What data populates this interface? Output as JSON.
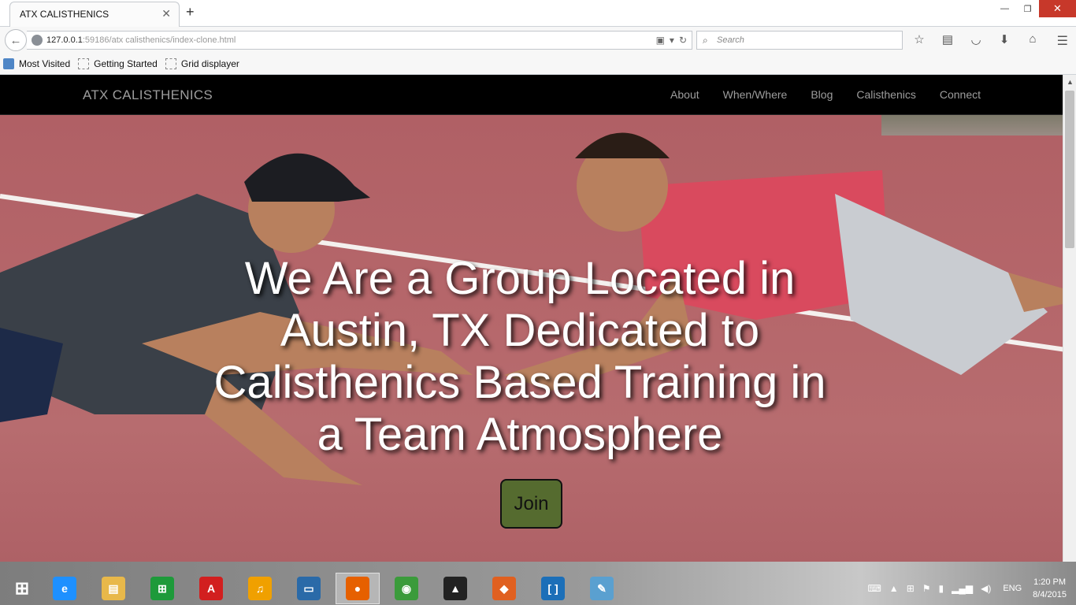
{
  "browser": {
    "tab_title": "ATX CALISTHENICS",
    "tab_close": "✕",
    "new_tab": "+",
    "url_host": "127.0.0.1",
    "url_rest": ":59186/atx calisthenics/index-clone.html",
    "search_placeholder": "Search",
    "win_minimize": "—",
    "win_restore": "❐",
    "win_close": "✕",
    "bookmarks": [
      "Most Visited",
      "Getting Started",
      "Grid displayer"
    ]
  },
  "site": {
    "brand": "ATX CALISTHENICS",
    "nav": [
      "About",
      "When/Where",
      "Blog",
      "Calisthenics",
      "Connect"
    ],
    "headline": "We Are a Group Located in Austin, TX Dedicated to Calisthenics Based Training in a Team Atmosphere",
    "join_label": "Join"
  },
  "taskbar": {
    "apps": [
      {
        "name": "internet-explorer-icon",
        "glyph": "e",
        "color": "#1e90ff"
      },
      {
        "name": "file-explorer-icon",
        "glyph": "▤",
        "color": "#e8b84a"
      },
      {
        "name": "store-icon",
        "glyph": "⊞",
        "color": "#1e9a3a"
      },
      {
        "name": "adobe-icon",
        "glyph": "A",
        "color": "#d21f1f"
      },
      {
        "name": "headphones-icon",
        "glyph": "♫",
        "color": "#f0a000"
      },
      {
        "name": "lenovo-icon",
        "glyph": "▭",
        "color": "#2a6aa8"
      },
      {
        "name": "firefox-icon",
        "glyph": "●",
        "color": "#e66000"
      },
      {
        "name": "chrome-icon",
        "glyph": "◉",
        "color": "#3b9b3b"
      },
      {
        "name": "inkscape-icon",
        "glyph": "▲",
        "color": "#222222"
      },
      {
        "name": "matlab-icon",
        "glyph": "◆",
        "color": "#e06020"
      },
      {
        "name": "brackets-icon",
        "glyph": "[ ]",
        "color": "#1c6fb8"
      },
      {
        "name": "paint-icon",
        "glyph": "✎",
        "color": "#5aa0d0"
      }
    ],
    "active_app_index": 6,
    "lang": "ENG",
    "time": "1:20 PM",
    "date": "8/4/2015"
  }
}
